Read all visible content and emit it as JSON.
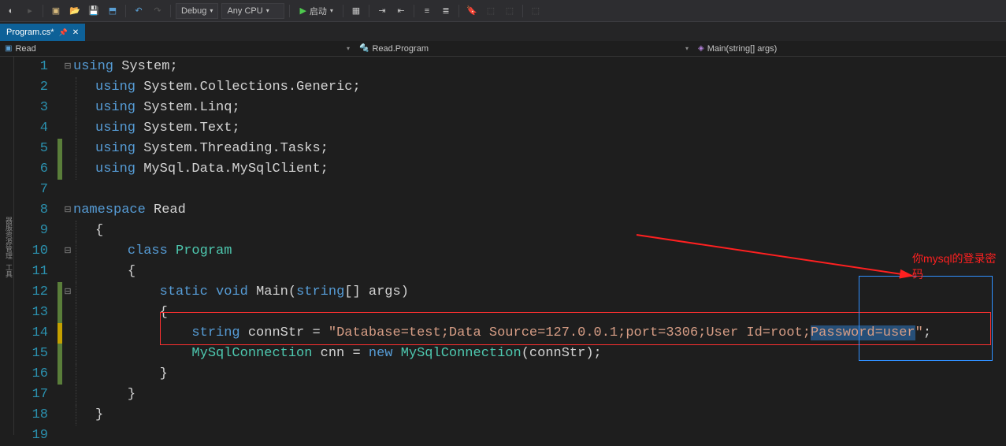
{
  "toolbar": {
    "config": "Debug",
    "platform": "Any CPU",
    "start_label": "启动"
  },
  "tab": {
    "filename": "Program.cs*"
  },
  "breadcrumb": {
    "c1": "Read",
    "c2": "Read.Program",
    "c3": "Main(string[] args)"
  },
  "code": {
    "l1": {
      "kw": "using",
      "ns": "System",
      "p": ";"
    },
    "l2": {
      "kw": "using",
      "ns": "System.Collections.Generic",
      "p": ";"
    },
    "l3": {
      "kw": "using",
      "ns": "System.Linq",
      "p": ";"
    },
    "l4": {
      "kw": "using",
      "ns": "System.Text",
      "p": ";"
    },
    "l5": {
      "kw": "using",
      "ns": "System.Threading.Tasks",
      "p": ";"
    },
    "l6": {
      "kw": "using",
      "ns": "MySql.Data.MySqlClient",
      "p": ";"
    },
    "l8": {
      "kw": "namespace",
      "name": "Read"
    },
    "l9": {
      "p": "{"
    },
    "l10": {
      "kw": "class",
      "name": "Program"
    },
    "l11": {
      "p": "{"
    },
    "l12": {
      "kw1": "static",
      "kw2": "void",
      "name": "Main",
      "sig": "(",
      "kw3": "string",
      "arr": "[] ",
      "arg": "args",
      ")": ")"
    },
    "l13": {
      "p": "{"
    },
    "l14": {
      "kw": "string",
      "var": "connStr",
      "eq": " = ",
      "str": "\"Database=test;Data Source=127.0.0.1;port=3306;User Id=root;",
      "str2": "Password=user",
      "str3": "\"",
      "p": ";"
    },
    "l15": {
      "cls": "MySqlConnection",
      "var": "cnn",
      "eq": " = ",
      "kw": "new",
      "cls2": "MySqlConnection",
      "open": "(",
      "arg": "connStr",
      "close": ")",
      "p": ";"
    },
    "l16": {
      "p": "}"
    },
    "l17": {
      "p": "}"
    },
    "l18": {
      "p": "}"
    }
  },
  "annotation": {
    "text": "你mysql的登录密码"
  }
}
